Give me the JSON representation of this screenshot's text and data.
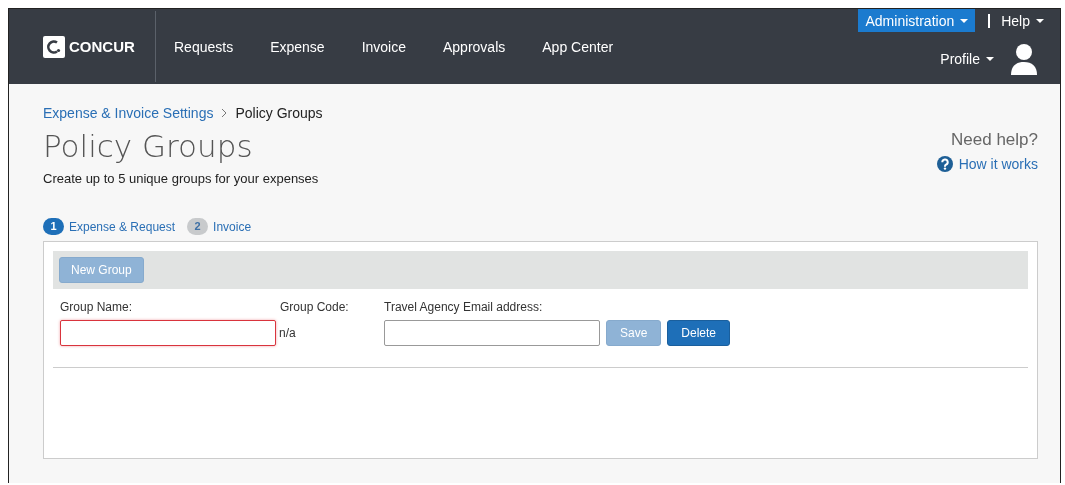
{
  "header": {
    "logo": "CONCUR",
    "nav": [
      {
        "label": "Requests"
      },
      {
        "label": "Expense"
      },
      {
        "label": "Invoice"
      },
      {
        "label": "Approvals"
      },
      {
        "label": "App Center"
      }
    ],
    "admin_menu": {
      "label": "Administration",
      "selected": true
    },
    "help_menu": {
      "label": "Help"
    },
    "profile_menu": {
      "label": "Profile"
    }
  },
  "breadcrumb": [
    {
      "label": "Expense & Invoice Settings",
      "kind": "link"
    },
    {
      "label": "Policy Groups",
      "kind": "current"
    }
  ],
  "title": "Policy Groups",
  "subtitle": "Create up to 5 unique groups for your expenses",
  "help": {
    "heading": "Need help?",
    "link": "How it works"
  },
  "steps": [
    {
      "number": "1",
      "label": "Expense & Request",
      "selected": true
    },
    {
      "number": "2",
      "label": "Invoice",
      "selected": false
    }
  ],
  "toolbar": {
    "buttons": [
      {
        "label": "New Group",
        "disabled": true
      }
    ]
  },
  "form": {
    "group_name": {
      "label": "Group Name:",
      "invalid": true
    },
    "group_code": {
      "label": "Group Code:",
      "value": "n/a"
    },
    "email": {
      "label": "Travel Agency Email address:"
    },
    "buttons": [
      {
        "label": "Save",
        "disabled": true
      },
      {
        "label": "Delete",
        "disabled": false
      }
    ]
  }
}
